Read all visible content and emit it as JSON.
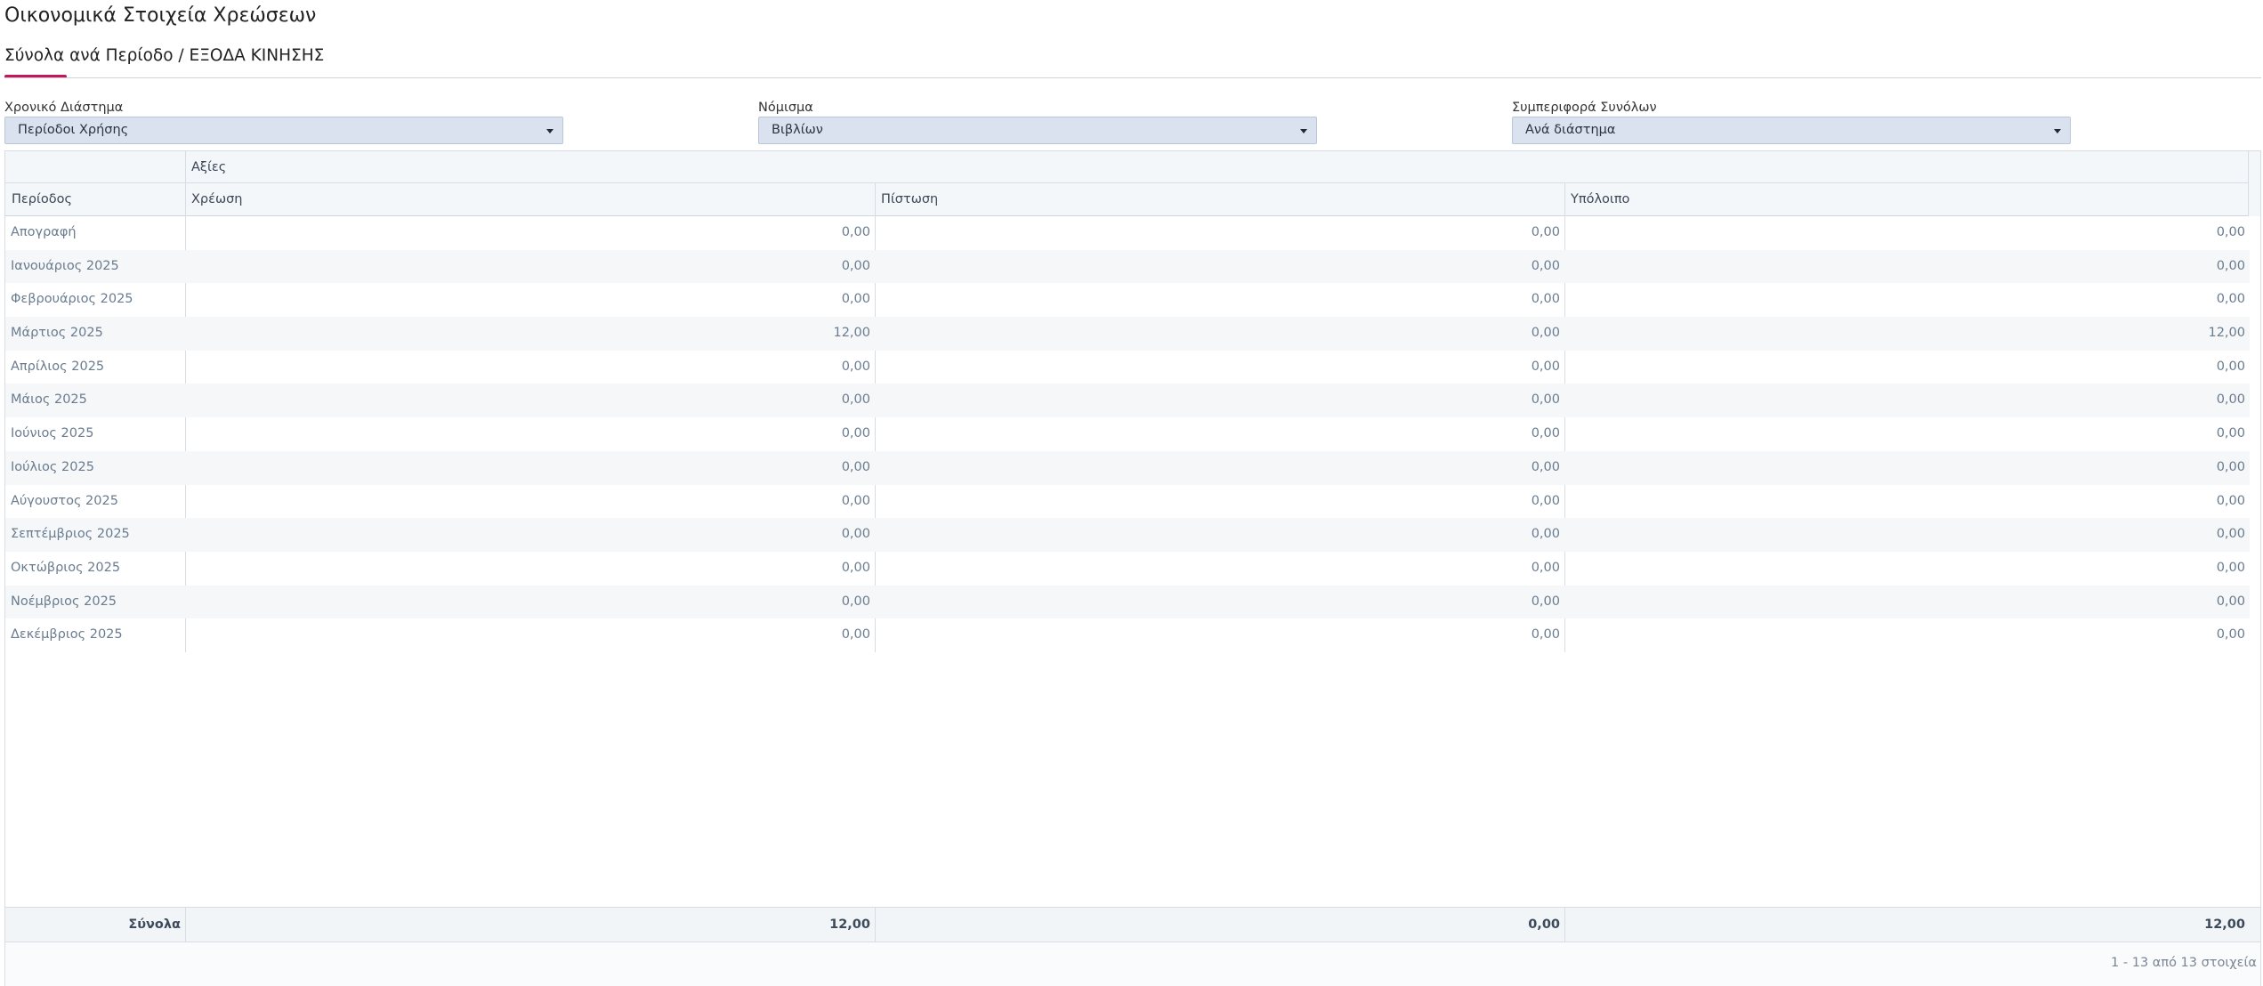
{
  "page": {
    "title": "Οικονομικά Στοιχεία Χρεώσεων",
    "subtitle": "Σύνολα ανά Περίοδο / ΕΞΟΔΑ ΚΙΝΗΣΗΣ"
  },
  "filters": [
    {
      "label": "Χρονικό Διάστημα",
      "value": "Περίοδοι Χρήσης"
    },
    {
      "label": "Νόμισμα",
      "value": "Βιβλίων"
    },
    {
      "label": "Συμπεριφορά Συνόλων",
      "value": "Ανά διάστημα"
    }
  ],
  "grid": {
    "group_header": "Αξίες",
    "columns": {
      "period": "Περίοδος",
      "debit": "Χρέωση",
      "credit": "Πίστωση",
      "balance": "Υπόλοιπο"
    },
    "rows": [
      {
        "period": "Απογραφή",
        "debit": "0,00",
        "credit": "0,00",
        "balance": "0,00"
      },
      {
        "period": "Ιανουάριος 2025",
        "debit": "0,00",
        "credit": "0,00",
        "balance": "0,00"
      },
      {
        "period": "Φεβρουάριος 2025",
        "debit": "0,00",
        "credit": "0,00",
        "balance": "0,00"
      },
      {
        "period": "Μάρτιος 2025",
        "debit": "12,00",
        "credit": "0,00",
        "balance": "12,00"
      },
      {
        "period": "Απρίλιος 2025",
        "debit": "0,00",
        "credit": "0,00",
        "balance": "0,00"
      },
      {
        "period": "Μάιος 2025",
        "debit": "0,00",
        "credit": "0,00",
        "balance": "0,00"
      },
      {
        "period": "Ιούνιος 2025",
        "debit": "0,00",
        "credit": "0,00",
        "balance": "0,00"
      },
      {
        "period": "Ιούλιος 2025",
        "debit": "0,00",
        "credit": "0,00",
        "balance": "0,00"
      },
      {
        "period": "Αύγουστος 2025",
        "debit": "0,00",
        "credit": "0,00",
        "balance": "0,00"
      },
      {
        "period": "Σεπτέμβριος 2025",
        "debit": "0,00",
        "credit": "0,00",
        "balance": "0,00"
      },
      {
        "period": "Οκτώβριος 2025",
        "debit": "0,00",
        "credit": "0,00",
        "balance": "0,00"
      },
      {
        "period": "Νοέμβριος 2025",
        "debit": "0,00",
        "credit": "0,00",
        "balance": "0,00"
      },
      {
        "period": "Δεκέμβριος 2025",
        "debit": "0,00",
        "credit": "0,00",
        "balance": "0,00"
      }
    ],
    "totals": {
      "label": "Σύνολα",
      "debit": "12,00",
      "credit": "0,00",
      "balance": "12,00"
    },
    "pager_info": "1 - 13 από 13 στοιχεία"
  },
  "colors": {
    "accent": "#c2185b",
    "select_bg": "#d9e2ee",
    "header_bg": "#f4f7fa"
  },
  "icons": {
    "dropdown": "caret-down-icon"
  }
}
